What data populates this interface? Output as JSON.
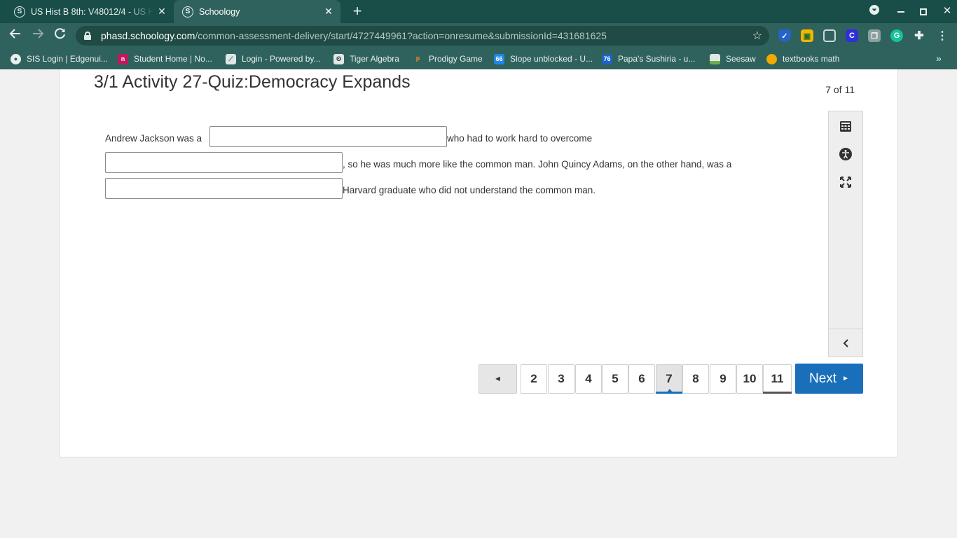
{
  "browser": {
    "tabs": [
      {
        "favicon": "S",
        "title": "US Hist B 8th: V48012/4 - US His"
      },
      {
        "favicon": "S",
        "title": "Schoology"
      }
    ],
    "new_tab": "+",
    "url_host": "phasd.schoology.com",
    "url_path": "/common-assessment-delivery/start/4727449961?action=onresume&submissionId=431681625",
    "bookmarks": [
      {
        "label": "SIS Login | Edgenui...",
        "icon": "globe-icon"
      },
      {
        "label": "Student Home | No...",
        "icon": "n-icon"
      },
      {
        "label": "Login - Powered by...",
        "icon": "login-icon"
      },
      {
        "label": "Tiger Algebra",
        "icon": "tiger-icon"
      },
      {
        "label": "Prodigy Game",
        "icon": "prodigy-icon"
      },
      {
        "label": "Slope unblocked - U...",
        "icon": "66-icon"
      },
      {
        "label": "Papa's Sushiria - u...",
        "icon": "76-icon"
      },
      {
        "label": "Seesaw",
        "icon": "seesaw-icon"
      },
      {
        "label": "textbooks math",
        "icon": "circle-icon"
      }
    ],
    "bookmark_more": "»"
  },
  "quiz": {
    "title": "3/1 Activity 27-Quiz:Democracy Expands",
    "position": "7 of 11",
    "question": {
      "part1": "Andrew Jackson was a",
      "part2": "who had to work hard to overcome",
      "part3": ", so he was much more like the common man. John Quincy Adams, on the other hand, was a",
      "part4": "Harvard graduate who did not understand the common man.",
      "blanks": [
        "",
        "",
        ""
      ]
    }
  },
  "tools": [
    "calculator-icon",
    "accessibility-icon",
    "fullscreen-icon",
    "collapse-icon"
  ],
  "pager": {
    "prev": "◄",
    "pages": [
      "2",
      "3",
      "4",
      "5",
      "6",
      "7",
      "8",
      "9",
      "10",
      "11"
    ],
    "current": "7",
    "next_label": "Next",
    "next_arrow": "►"
  },
  "colors": {
    "chrome_dark": "#194d47",
    "chrome": "#2f625c",
    "accent": "#1a6fba"
  }
}
